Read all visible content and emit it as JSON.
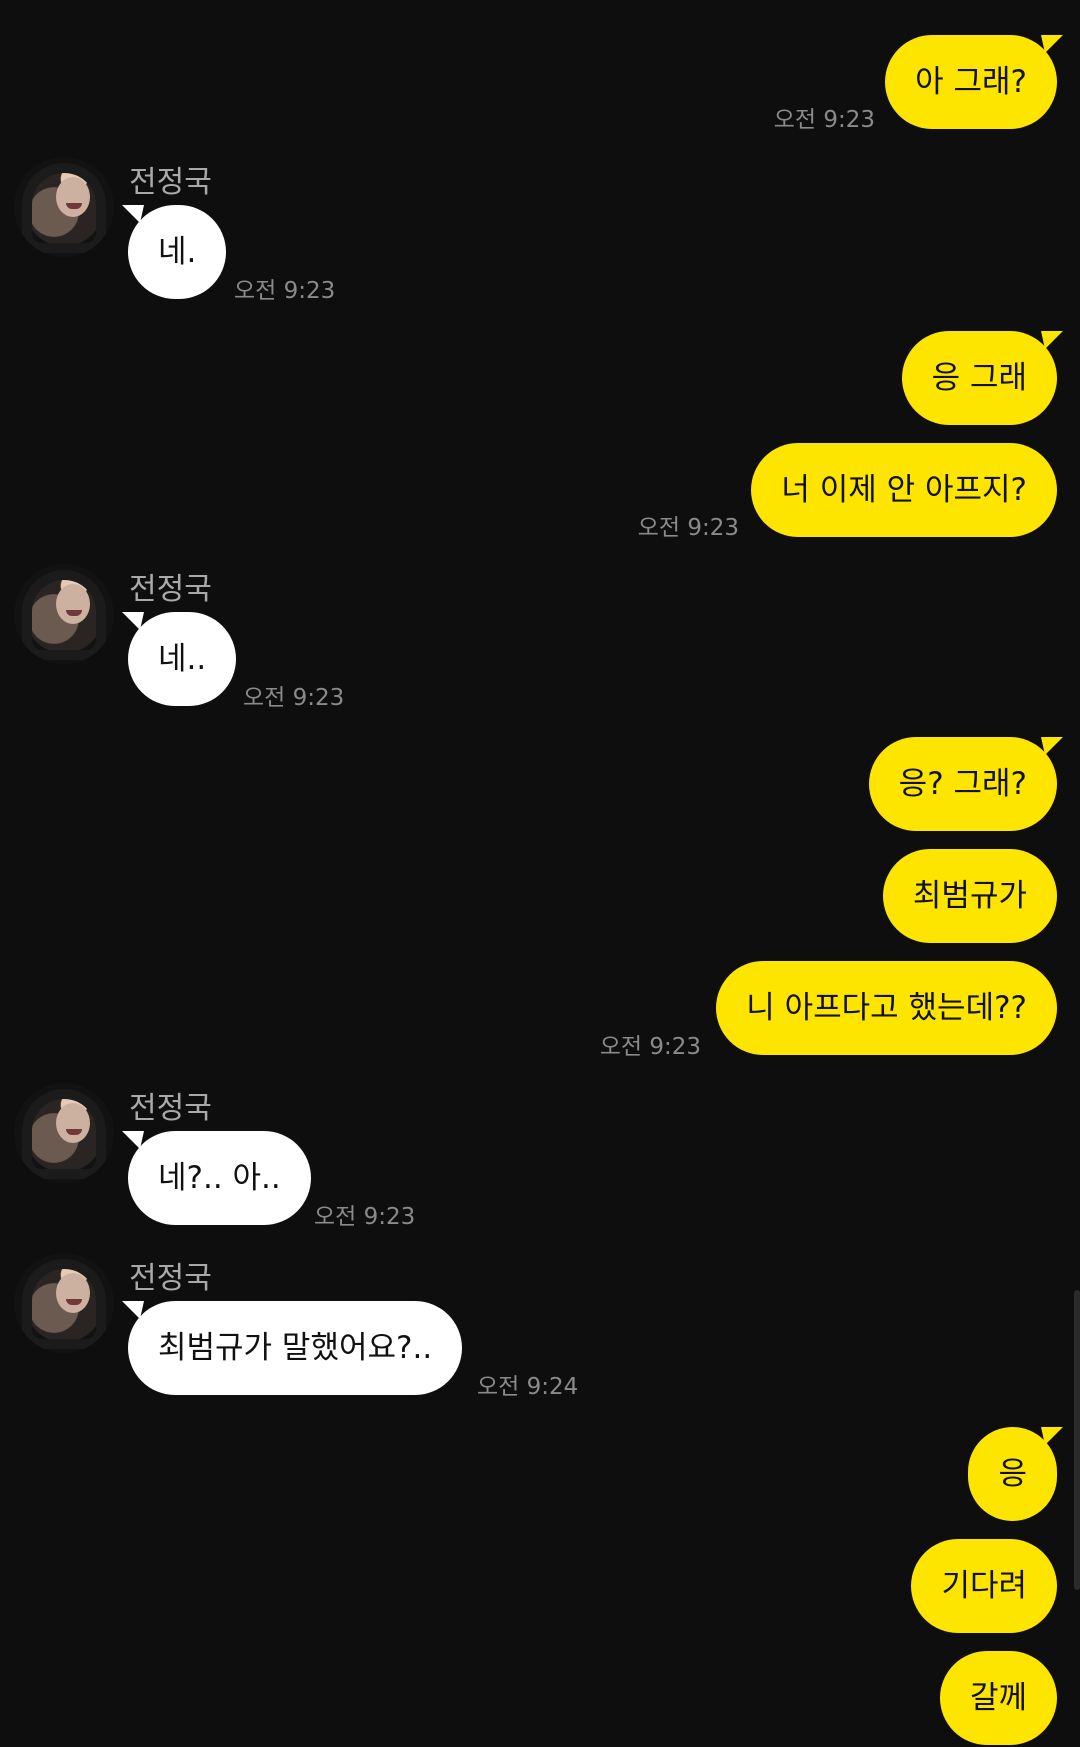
{
  "contact": {
    "name": "전정국"
  },
  "messages": [
    {
      "id": 1,
      "from": "me",
      "text": "아 그래?",
      "time": "오전 9:23"
    },
    {
      "id": 2,
      "from": "them",
      "text": "네.",
      "time": "오전 9:23"
    },
    {
      "id": 3,
      "from": "me",
      "text": "응 그래",
      "time": ""
    },
    {
      "id": 4,
      "from": "me",
      "text": "너 이제 안 아프지?",
      "time": "오전 9:23"
    },
    {
      "id": 5,
      "from": "them",
      "text": "네..",
      "time": "오전 9:23"
    },
    {
      "id": 6,
      "from": "me",
      "text": "응? 그래?",
      "time": ""
    },
    {
      "id": 7,
      "from": "me",
      "text": "최범규가",
      "time": ""
    },
    {
      "id": 8,
      "from": "me",
      "text": "니 아프다고 했는데??",
      "time": "오전 9:23"
    },
    {
      "id": 9,
      "from": "them",
      "text": "네?.. 아..",
      "time": "오전 9:23"
    },
    {
      "id": 10,
      "from": "them",
      "text": "최범규가 말했어요?..",
      "time": "오전 9:24"
    },
    {
      "id": 11,
      "from": "me",
      "text": "응",
      "time": ""
    },
    {
      "id": 12,
      "from": "me",
      "text": "기다려",
      "time": ""
    },
    {
      "id": 13,
      "from": "me",
      "text": "갈께",
      "time": ""
    }
  ],
  "colors": {
    "background": "#0e0e0e",
    "my_bubble": "#fee500",
    "their_bubble": "#ffffff",
    "timestamp": "#8a8a8a",
    "sender_name": "#a9a9a9"
  }
}
